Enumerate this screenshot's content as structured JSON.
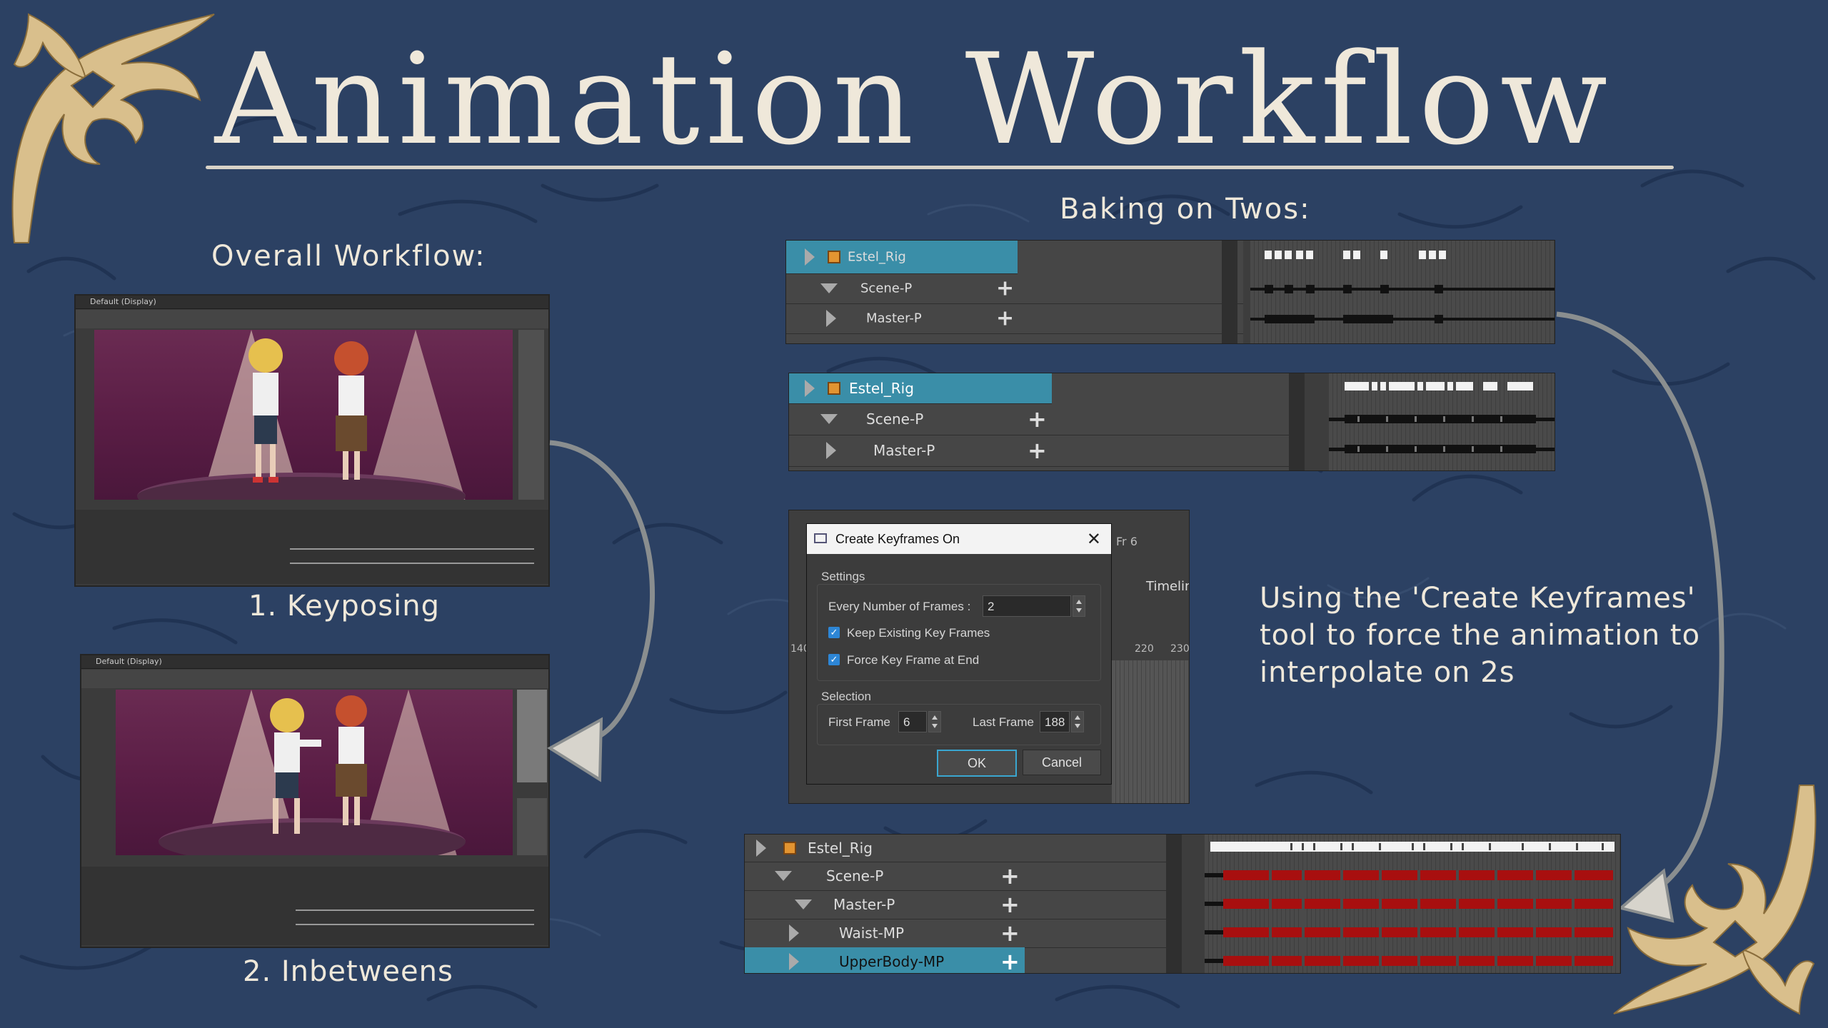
{
  "title": "Animation Workflow",
  "overall_heading": "Overall Workflow:",
  "baking_heading": "Baking on Twos:",
  "captions": {
    "step1": "1. Keyposing",
    "step2": "2. Inbetweens"
  },
  "description": "Using the 'Create Keyframes' tool to force the animation to interpolate on 2s",
  "timeline1": {
    "rows": [
      "Estel_Rig",
      "Scene-P",
      "Master-P"
    ]
  },
  "timeline2": {
    "rows": [
      "Estel_Rig",
      "Scene-P",
      "Master-P"
    ]
  },
  "timeline3": {
    "rows": [
      "Estel_Rig",
      "Scene-P",
      "Master-P",
      "Waist-MP",
      "UpperBody-MP"
    ]
  },
  "dialog": {
    "title": "Create Keyframes On",
    "settings_label": "Settings",
    "every_label": "Every Number of Frames :",
    "every_value": "2",
    "keep_label": "Keep Existing Key Frames",
    "keep_checked": true,
    "force_label": "Force Key Frame at End",
    "force_checked": true,
    "selection_label": "Selection",
    "first_label": "First Frame",
    "first_value": "6",
    "last_label": "Last Frame",
    "last_value": "188",
    "ok_label": "OK",
    "cancel_label": "Cancel"
  },
  "background_timeline": {
    "frame_label": "Fr 6",
    "tab_label": "Timelin",
    "ticks": [
      "140",
      "220",
      "230"
    ]
  },
  "colors": {
    "background": "#2c4163",
    "text": "#efe8da",
    "gold": "#d9bf8c",
    "selection": "#3a8ea8",
    "keyframe_red": "#a80f0f"
  }
}
